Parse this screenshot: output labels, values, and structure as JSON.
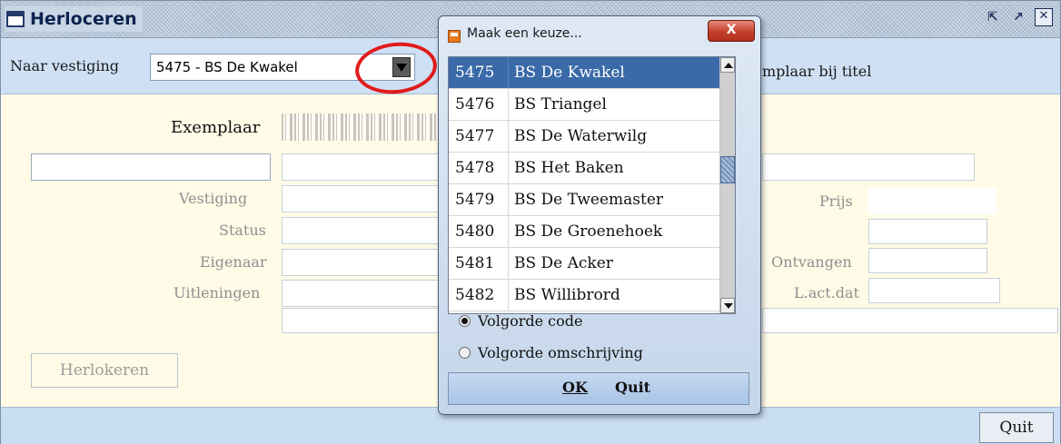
{
  "window": {
    "title": "Herloceren",
    "controls": [
      "restore-icon",
      "maximize-icon",
      "close-icon"
    ]
  },
  "toolbar": {
    "branch_label": "Naar vestiging",
    "branch_value": "5475 - BS De Kwakel",
    "right_text": "mplaar bij titel"
  },
  "form": {
    "exemplaar_label": "Exemplaar",
    "vestiging_label": "Vestiging",
    "status_label": "Status",
    "eigenaar_label": "Eigenaar",
    "uitleningen_label": "Uitleningen",
    "prijs_label": "Prijs",
    "ontvangen_label": "Ontvangen",
    "lactdat_label": "L.act.dat",
    "herlokeren_button": "Herlokeren",
    "quit_button": "Quit"
  },
  "popup": {
    "title": "Maak een keuze...",
    "close_label": "X",
    "items": [
      {
        "code": "5475",
        "name": "BS De Kwakel",
        "selected": true
      },
      {
        "code": "5476",
        "name": "BS Triangel",
        "selected": false
      },
      {
        "code": "5477",
        "name": "BS De Waterwilg",
        "selected": false
      },
      {
        "code": "5478",
        "name": "BS Het Baken",
        "selected": false
      },
      {
        "code": "5479",
        "name": "BS De Tweemaster",
        "selected": false
      },
      {
        "code": "5480",
        "name": "BS De Groenehoek",
        "selected": false
      },
      {
        "code": "5481",
        "name": "BS De Acker",
        "selected": false
      },
      {
        "code": "5482",
        "name": "BS Willibrord",
        "selected": false
      }
    ],
    "radio_code": "Volgorde code",
    "radio_desc": "Volgorde omschrijving",
    "radio_selected": "code",
    "ok_label": "OK",
    "quit_label": "Quit"
  },
  "colors": {
    "toolbar_bg": "#cfe0f4",
    "form_bg": "#fffbe6",
    "selection": "#3a6aa8",
    "highlight_ellipse": "#e01b1b"
  }
}
